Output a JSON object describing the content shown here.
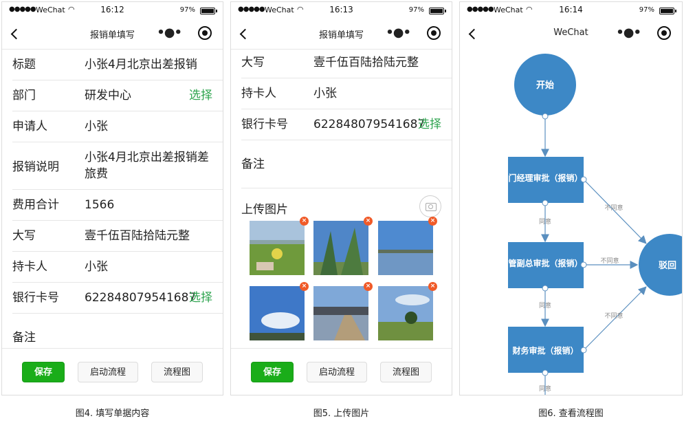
{
  "status": {
    "carrier": "WeChat",
    "battery": "97%",
    "time1": "16:12",
    "time2": "16:13",
    "time3": "16:14"
  },
  "screen1": {
    "title": "报销单填写",
    "fields": {
      "title_label": "标题",
      "title_value": "小张4月北京出差报销",
      "dept_label": "部门",
      "dept_value": "研发中心",
      "dept_pick": "选择",
      "applicant_label": "申请人",
      "applicant_value": "小张",
      "desc_label": "报销说明",
      "desc_value": "小张4月北京出差报销差旅费",
      "total_label": "费用合计",
      "total_value": "1566",
      "capital_label": "大写",
      "capital_value": "壹千伍百陆拾陆元整",
      "holder_label": "持卡人",
      "holder_value": "小张",
      "card_label": "银行卡号",
      "card_value": "622848079541687",
      "card_pick": "选择",
      "remark_label": "备注"
    },
    "buttons": {
      "save": "保存",
      "start": "启动流程",
      "chart": "流程图"
    }
  },
  "screen2": {
    "title": "报销单填写",
    "fields": {
      "capital_label": "大写",
      "capital_value": "壹千伍百陆拾陆元整",
      "holder_label": "持卡人",
      "holder_value": "小张",
      "card_label": "银行卡号",
      "card_value": "622848079541687",
      "card_pick": "选择",
      "remark_label": "备注",
      "upload_label": "上传图片"
    },
    "buttons": {
      "save": "保存",
      "start": "启动流程",
      "chart": "流程图"
    },
    "thumb_colors": [
      "#7aa14a",
      "#4f86c8",
      "#5f93d1",
      "#3e78c8",
      "#6f8fb0",
      "#7fa8d8"
    ]
  },
  "screen3": {
    "title": "WeChat",
    "flow": {
      "start": "开始",
      "reject": "驳回",
      "node1": "门经理审批（报销）",
      "node2": "管副总审批（报销）",
      "node3": "财务审批（报销）",
      "agree": "同意",
      "disagree": "不同意"
    },
    "colors": {
      "node": "#3d88c6",
      "edge": "#5a8fbf"
    }
  },
  "captions": {
    "c1": "图4. 填写单据内容",
    "c2": "图5. 上传图片",
    "c3": "图6. 查看流程图"
  }
}
